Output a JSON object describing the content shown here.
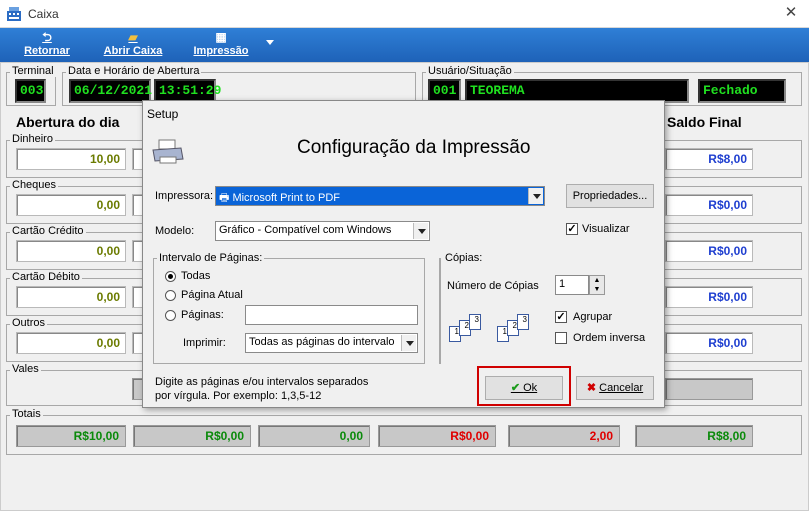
{
  "window": {
    "title": "Caixa"
  },
  "toolbar": {
    "retornar": "Retornar",
    "abrir_caixa": "Abrir Caixa",
    "impressao": "Impressão"
  },
  "header": {
    "terminal_label": "Terminal",
    "terminal_value": "003",
    "abertura_label": "Data e Horário de Abertura",
    "date": "06/12/2021",
    "time": "13:51:29",
    "usuario_label": "Usuário/Situação",
    "user_code": "001",
    "user_name": "TEOREMA",
    "status": "Fechado"
  },
  "columns": {
    "abertura": "Abertura do dia",
    "saldo_final": "Saldo Final"
  },
  "rows": [
    {
      "label": "Dinheiro",
      "abertura": "10,00",
      "saldo": "R$8,00"
    },
    {
      "label": "Cheques",
      "abertura": "0,00",
      "saldo": "R$0,00"
    },
    {
      "label": "Cartão Crédito",
      "abertura": "0,00",
      "saldo": "R$0,00"
    },
    {
      "label": "Cartão Débito",
      "abertura": "0,00",
      "saldo": "R$0,00"
    },
    {
      "label": "Outros",
      "abertura": "0,00",
      "saldo": "R$0,00"
    }
  ],
  "vales_label": "Vales",
  "totais": {
    "label": "Totais",
    "values": [
      "R$10,00",
      "R$0,00",
      "0,00",
      "R$0,00",
      "2,00",
      "R$8,00"
    ]
  },
  "dialog": {
    "title": "Setup",
    "heading": "Configuração da Impressão",
    "impressora_label": "Impressora:",
    "impressora_value": "Microsoft Print to PDF",
    "propriedades": "Propriedades...",
    "modelo_label": "Modelo:",
    "modelo_value": "Gráfico - Compatível com Windows",
    "visualizar": "Visualizar",
    "intervalo_label": "Intervalo de Páginas:",
    "todas": "Todas",
    "pagina_atual": "Página Atual",
    "paginas": "Páginas:",
    "imprimir_label": "Imprimir:",
    "imprimir_value": "Todas as páginas do intervalo",
    "copias_label": "Cópias:",
    "numero_copias_label": "Número de Cópias",
    "numero_copias": "1",
    "agrupar": "Agrupar",
    "ordem_inversa": "Ordem inversa",
    "hint_line1": "Digite as páginas e/ou intervalos separados",
    "hint_line2": "por vírgula.  Por exemplo: 1,3,5-12",
    "ok": "Ok",
    "cancelar": "Cancelar"
  },
  "colors": {
    "toolbar": "#1e62b8",
    "lcd_bg": "#000000",
    "lcd_text": "#20e020",
    "ok_highlight": "#d00000"
  }
}
